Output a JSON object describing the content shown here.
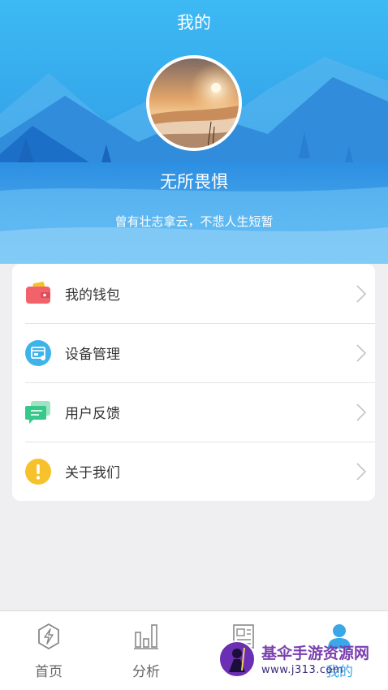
{
  "header": {
    "title": "我的",
    "username": "无所畏惧",
    "motto": "曾有壮志拿云，不悲人生短暂"
  },
  "menu": [
    {
      "label": "我的钱包",
      "icon": "wallet-icon",
      "color": "#f2626a"
    },
    {
      "label": "设备管理",
      "icon": "device-icon",
      "color": "#3eb3ea"
    },
    {
      "label": "用户反馈",
      "icon": "feedback-icon",
      "color": "#37c98a"
    },
    {
      "label": "关于我们",
      "icon": "info-icon",
      "color": "#f7c12b"
    }
  ],
  "tabs": [
    {
      "label": "首页",
      "icon": "home-icon"
    },
    {
      "label": "分析",
      "icon": "chart-icon"
    },
    {
      "label": "",
      "icon": "news-icon"
    },
    {
      "label": "我的",
      "icon": "user-icon",
      "active": true
    }
  ],
  "watermark": {
    "title": "基伞手游资源网",
    "url": "www.j313.com"
  },
  "colors": {
    "header_top": "#3cb8f2",
    "header_bottom": "#1f7fd6",
    "accent": "#3aa7e8"
  }
}
